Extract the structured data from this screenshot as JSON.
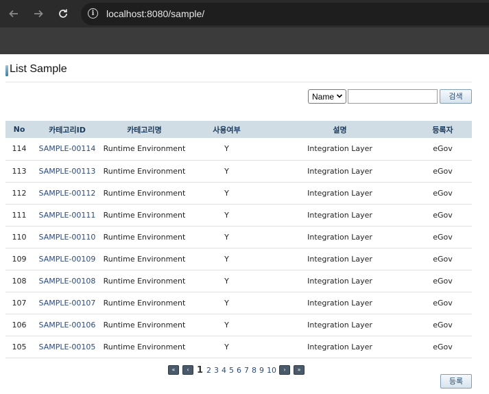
{
  "browser": {
    "url": "localhost:8080/sample/",
    "icons": {
      "back": "arrow-left-icon",
      "forward": "arrow-right-icon",
      "reload": "reload-icon",
      "info": "info-icon"
    }
  },
  "page": {
    "title": "List Sample",
    "search": {
      "select_value": "Name",
      "input_value": "",
      "button_label": "검색"
    },
    "table": {
      "columns": [
        "No",
        "카테고리ID",
        "카테고리명",
        "사용여부",
        "설명",
        "등록자"
      ],
      "rows": [
        [
          "114",
          "SAMPLE-00114",
          "Runtime Environment",
          "Y",
          "Integration Layer",
          "eGov"
        ],
        [
          "113",
          "SAMPLE-00113",
          "Runtime Environment",
          "Y",
          "Integration Layer",
          "eGov"
        ],
        [
          "112",
          "SAMPLE-00112",
          "Runtime Environment",
          "Y",
          "Integration Layer",
          "eGov"
        ],
        [
          "111",
          "SAMPLE-00111",
          "Runtime Environment",
          "Y",
          "Integration Layer",
          "eGov"
        ],
        [
          "110",
          "SAMPLE-00110",
          "Runtime Environment",
          "Y",
          "Integration Layer",
          "eGov"
        ],
        [
          "109",
          "SAMPLE-00109",
          "Runtime Environment",
          "Y",
          "Integration Layer",
          "eGov"
        ],
        [
          "108",
          "SAMPLE-00108",
          "Runtime Environment",
          "Y",
          "Integration Layer",
          "eGov"
        ],
        [
          "107",
          "SAMPLE-00107",
          "Runtime Environment",
          "Y",
          "Integration Layer",
          "eGov"
        ],
        [
          "106",
          "SAMPLE-00106",
          "Runtime Environment",
          "Y",
          "Integration Layer",
          "eGov"
        ],
        [
          "105",
          "SAMPLE-00105",
          "Runtime Environment",
          "Y",
          "Integration Layer",
          "eGov"
        ]
      ]
    },
    "pagination": {
      "first": "«",
      "prev": "‹",
      "pages": [
        "1",
        "2",
        "3",
        "4",
        "5",
        "6",
        "7",
        "8",
        "9",
        "10"
      ],
      "current": "1",
      "next": "›",
      "last": "»"
    },
    "register_button": "등록"
  }
}
